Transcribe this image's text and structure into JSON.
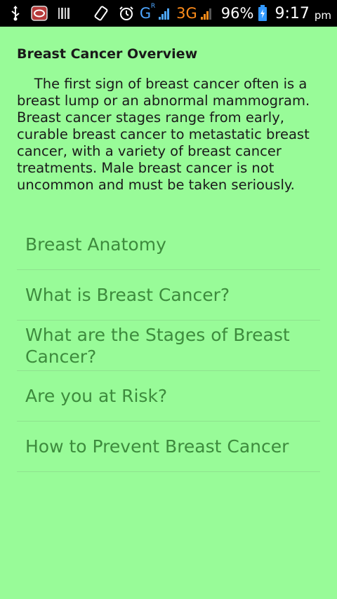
{
  "status_bar": {
    "network_g": "G",
    "network_g_superscript": "R",
    "network_3g": "3G",
    "battery": "96%",
    "time": "9:17",
    "ampm": "pm",
    "icons": [
      "usb-icon",
      "message-icon",
      "barcode-icon",
      "screen-rotate-icon",
      "alarm-icon",
      "signal-icon",
      "signal-icon",
      "battery-icon"
    ]
  },
  "overview": {
    "title": "Breast Cancer Overview",
    "text": "    The first sign of breast cancer often is a breast lump or an abnormal mammogram. Breast cancer stages range from early, curable breast cancer to metastatic breast cancer, with a variety of breast cancer treatments. Male breast cancer is not uncommon and must be taken seriously."
  },
  "menu": {
    "items": [
      {
        "label": "Breast Anatomy"
      },
      {
        "label": "What is Breast Cancer?"
      },
      {
        "label": "What are the Stages of Breast Cancer?"
      },
      {
        "label": "Are you at Risk?"
      },
      {
        "label": "How to Prevent Breast Cancer"
      }
    ]
  },
  "colors": {
    "background": "#98fb98",
    "menu_text": "#3d8b3d",
    "divider": "#8ee28e"
  }
}
